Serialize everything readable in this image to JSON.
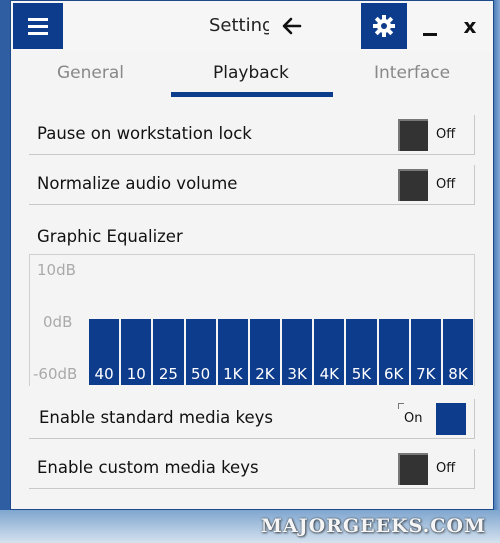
{
  "window": {
    "title": "Settings",
    "menu_icon": "hamburger-icon",
    "back_icon": "back-arrow-icon",
    "settings_icon": "gear-icon",
    "minimize_icon": "minimize-icon",
    "close_glyph": "x"
  },
  "tabs": [
    {
      "label": "General",
      "active": false
    },
    {
      "label": "Playback",
      "active": true
    },
    {
      "label": "Interface",
      "active": false
    }
  ],
  "settings": {
    "pause_lock": {
      "label": "Pause on workstation lock",
      "state": "Off"
    },
    "normalize": {
      "label": "Normalize audio volume",
      "state": "Off"
    },
    "standard_keys": {
      "label": "Enable standard media keys",
      "state": "On"
    },
    "custom_keys": {
      "label": "Enable custom media keys",
      "state": "Off"
    }
  },
  "equalizer": {
    "title": "Graphic Equalizer",
    "scale": {
      "top": "10dB",
      "mid": "0dB",
      "bottom": "-60dB"
    },
    "bands": [
      {
        "label": "40",
        "gain_db": 0
      },
      {
        "label": "10",
        "gain_db": 0
      },
      {
        "label": "25",
        "gain_db": 0
      },
      {
        "label": "50",
        "gain_db": 0
      },
      {
        "label": "1K",
        "gain_db": 0
      },
      {
        "label": "2K",
        "gain_db": 0
      },
      {
        "label": "3K",
        "gain_db": 0
      },
      {
        "label": "4K",
        "gain_db": 0
      },
      {
        "label": "5K",
        "gain_db": 0
      },
      {
        "label": "6K",
        "gain_db": 0
      },
      {
        "label": "7K",
        "gain_db": 0
      },
      {
        "label": "8K",
        "gain_db": 0
      }
    ]
  },
  "watermark": "MAJORGEEKS.COM",
  "colors": {
    "accent": "#0e3c8c",
    "toggle_off": "#333333"
  }
}
